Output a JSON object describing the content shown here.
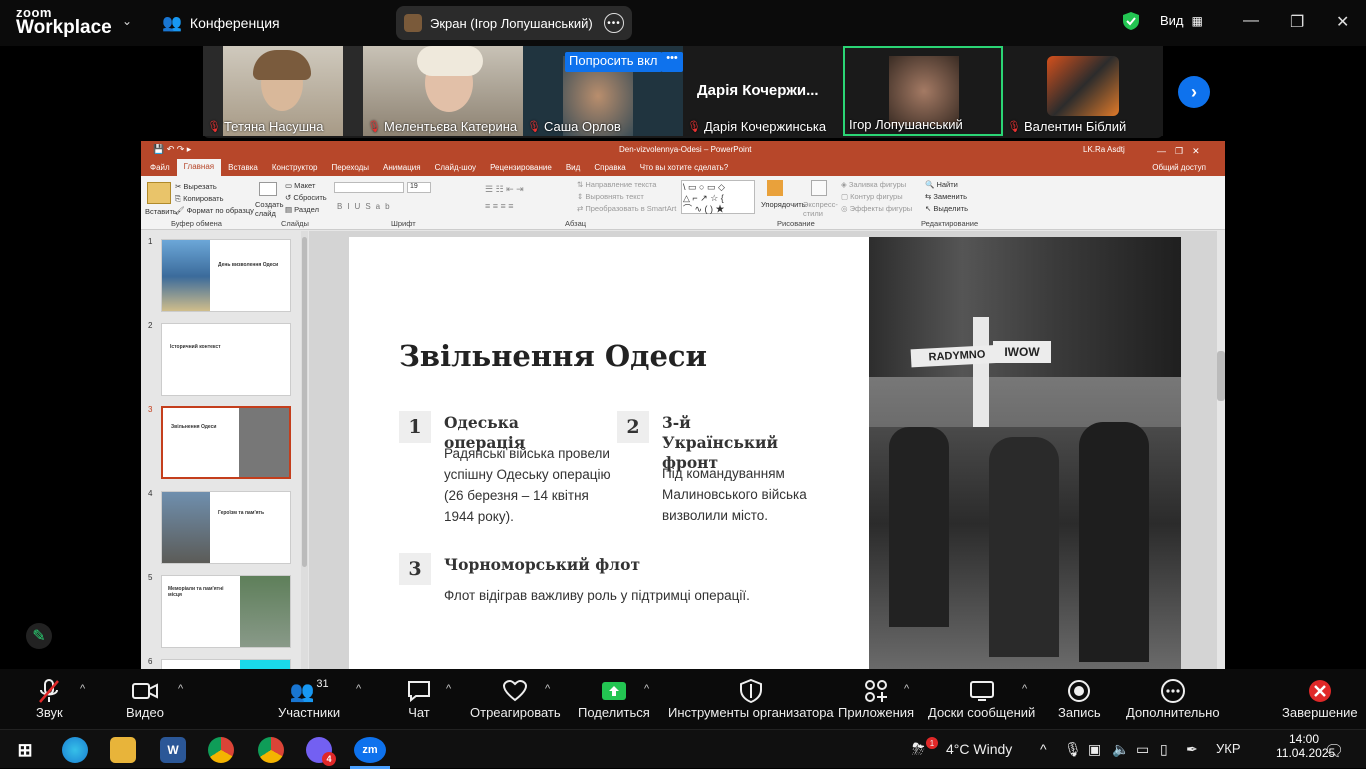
{
  "zoom": {
    "logo_top": "zoom",
    "logo_bottom": "Workplace",
    "meeting_label": "Конференция",
    "share_title": "Экран (Ігор Лопушанський)",
    "view_label": "Вид"
  },
  "participants": [
    {
      "name": "Тетяна Насушна",
      "muted": true
    },
    {
      "name": "Мелентьєва Катерина",
      "muted": true
    },
    {
      "name": "Саша Орлов",
      "muted": true,
      "overlay": "Попросить вкл"
    },
    {
      "name": "Дарія Кочержинська",
      "muted": true,
      "big_name": "Дарія Кочержи..."
    },
    {
      "name": "Ігор Лопушанський",
      "muted": false,
      "active": true
    },
    {
      "name": "Валентин Біблий",
      "muted": true
    }
  ],
  "ppt": {
    "title": "Den-vizvolennya-Odesi  –  PowerPoint",
    "user": "LK.Ra Asdtj",
    "share_access": "Общий доступ",
    "tabs": [
      "Файл",
      "Главная",
      "Вставка",
      "Конструктор",
      "Переходы",
      "Анимация",
      "Слайд-шоу",
      "Рецензирование",
      "Вид",
      "Справка",
      "Что вы хотите сделать?"
    ],
    "active_tab": "Главная",
    "ribbon": {
      "paste": "Вставить",
      "cut": "Вырезать",
      "copy": "Копировать",
      "format_painter": "Формат по образцу",
      "clipboard": "Буфер обмена",
      "new_slide": "Создать слайд",
      "layout": "Макет",
      "reset": "Сбросить",
      "section": "Раздел",
      "slides": "Слайды",
      "font_size": "19",
      "font": "Шрифт",
      "text_direction": "Направление текста",
      "align_text": "Выровнять текст",
      "smartart": "Преобразовать в SmartArt",
      "paragraph": "Абзац",
      "arrange": "Упорядочить",
      "quick_styles": "Экспресс-стили",
      "shape_fill": "Заливка фигуры",
      "shape_outline": "Контур фигуры",
      "shape_effects": "Эффекты фигуры",
      "drawing": "Рисование",
      "find": "Найти",
      "replace": "Заменить",
      "select": "Выделить",
      "editing": "Редактирование"
    },
    "thumbs": [
      {
        "num": "1",
        "title": "День визволення Одеси"
      },
      {
        "num": "2",
        "title": "Історичний контекст"
      },
      {
        "num": "3",
        "title": "Звільнення Одеси"
      },
      {
        "num": "4",
        "title": "Героїзм та пам'ять"
      },
      {
        "num": "5",
        "title": "Меморіали та пам'ятні місця"
      },
      {
        "num": "6",
        "title": ""
      }
    ]
  },
  "slide": {
    "title": "Звільнення Одеси",
    "items": [
      {
        "num": "1",
        "heading": "Одеська операція",
        "body": "Радянські війська провели успішну Одеську операцію (26 березня – 14 квітня 1944 року)."
      },
      {
        "num": "2",
        "heading": "3-й Український фронт",
        "body": "Під командуванням Малиновського війська визволили місто."
      },
      {
        "num": "3",
        "heading": "Чорноморський флот",
        "body": "Флот відіграв важливу роль у підтримці операції."
      }
    ],
    "photo_signs": [
      "RADYMNO",
      "IWOW"
    ]
  },
  "toolbar": {
    "audio": "Звук",
    "video": "Видео",
    "participants": "Участники",
    "participants_count": "31",
    "chat": "Чат",
    "react": "Отреагировать",
    "share": "Поделиться",
    "host_tools": "Инструменты организатора",
    "apps": "Приложения",
    "whiteboards": "Доски сообщений",
    "record": "Запись",
    "more": "Дополнительно",
    "end": "Завершение"
  },
  "taskbar": {
    "weather": "4°C  Windy",
    "lang": "УКР",
    "time": "14:00",
    "date": "11.04.2025",
    "viber_badge": "4",
    "weather_badge": "1"
  },
  "colors": {
    "ppt_red": "#b7472a",
    "zoom_blue": "#0e72ed",
    "active_green": "#2bd575",
    "end_red": "#e02828"
  }
}
